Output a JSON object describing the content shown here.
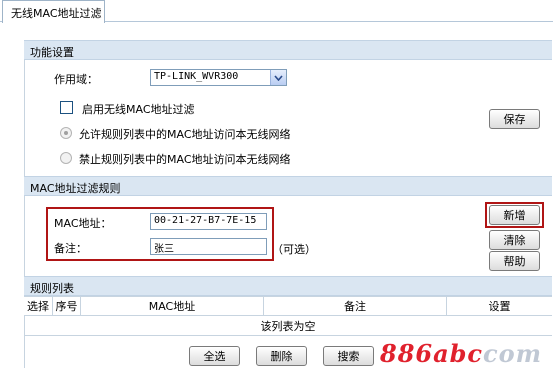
{
  "tab": {
    "label": "无线MAC地址过滤"
  },
  "function_settings": {
    "title": "功能设置",
    "scope_label": "作用域：",
    "scope_value": "TP-LINK_WVR300",
    "enable_label": "启用无线MAC地址过滤",
    "enable_checked": false,
    "allow_label": "允许规则列表中的MAC地址访问本无线网络",
    "deny_label": "禁止规则列表中的MAC地址访问本无线网络",
    "save_label": "保存"
  },
  "rules": {
    "title": "MAC地址过滤规则",
    "mac_label": "MAC地址：",
    "mac_value": "00-21-27-B7-7E-15",
    "note_label": "备注：",
    "note_value": "张三",
    "optional_hint": "（可选）",
    "add_label": "新增",
    "clear_label": "清除",
    "help_label": "帮助"
  },
  "rule_list": {
    "title": "规则列表",
    "columns": [
      "选择",
      "序号",
      "MAC地址",
      "备注",
      "设置"
    ],
    "empty_text": "该列表为空"
  },
  "bottom_buttons": {
    "select_all": "全选",
    "delete": "删除",
    "search": "搜索"
  },
  "watermark": {
    "text": "886abc",
    "suffix": "com"
  },
  "colors": {
    "section_header_bg": "#dae6f2",
    "highlight_border": "#b01515",
    "watermark": "#e0212d"
  }
}
